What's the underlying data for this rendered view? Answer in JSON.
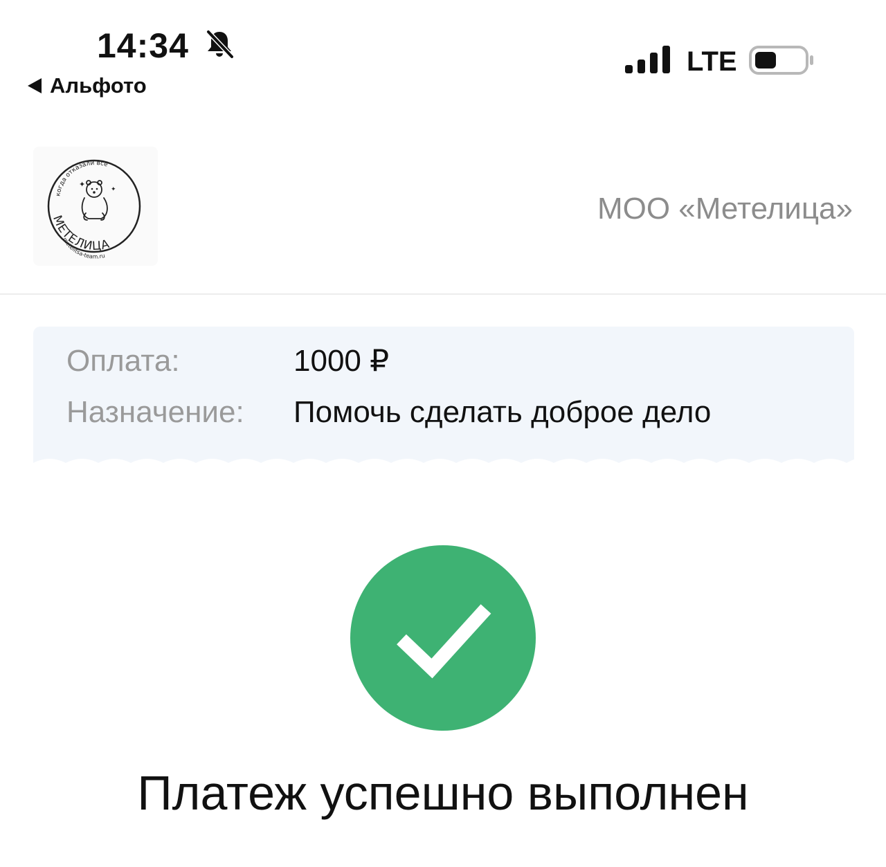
{
  "status_bar": {
    "time": "14:34",
    "back_app": "Альфото",
    "network": "LTE"
  },
  "merchant": {
    "name": "МОО «Метелица»",
    "logo_text_top": "когда отказали все",
    "logo_text_middle": "МЕТЕЛИЦА",
    "logo_text_bottom": "metelitsa-team.ru"
  },
  "payment": {
    "amount_label": "Оплата:",
    "amount_value": "1000 ₽",
    "purpose_label": "Назначение:",
    "purpose_value": "Помочь сделать доброе дело"
  },
  "result": {
    "message": "Платеж успешно выполнен",
    "accent_color": "#3eb273"
  }
}
